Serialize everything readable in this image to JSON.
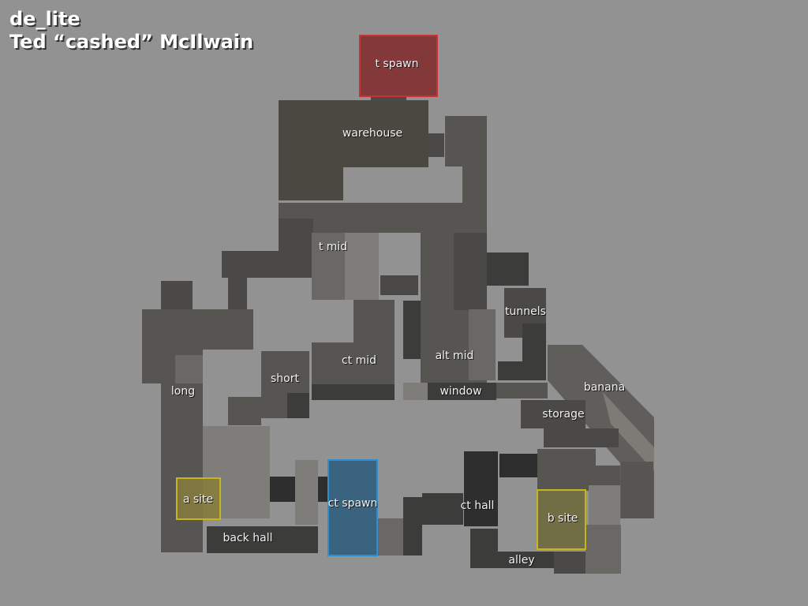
{
  "header": {
    "map_name": "de_lite",
    "author": "Ted “cashed” McIlwain"
  },
  "colors": {
    "background": "#929292",
    "t_spawn": "#c83232",
    "ct_spawn": "#2e8fd0",
    "bombsite": "#c8b41e"
  },
  "zones": {
    "t_spawn": "t spawn",
    "ct_spawn": "ct spawn",
    "a_site": "a site",
    "b_site": "b site"
  },
  "areas": {
    "warehouse": "warehouse",
    "t_mid": "t mid",
    "tunnels": "tunnels",
    "ct_mid": "ct mid",
    "alt_mid": "alt mid",
    "short": "short",
    "long": "long",
    "window": "window",
    "banana": "banana",
    "storage": "storage",
    "ct_hall": "ct hall",
    "back_hall": "back hall",
    "alley": "alley"
  }
}
